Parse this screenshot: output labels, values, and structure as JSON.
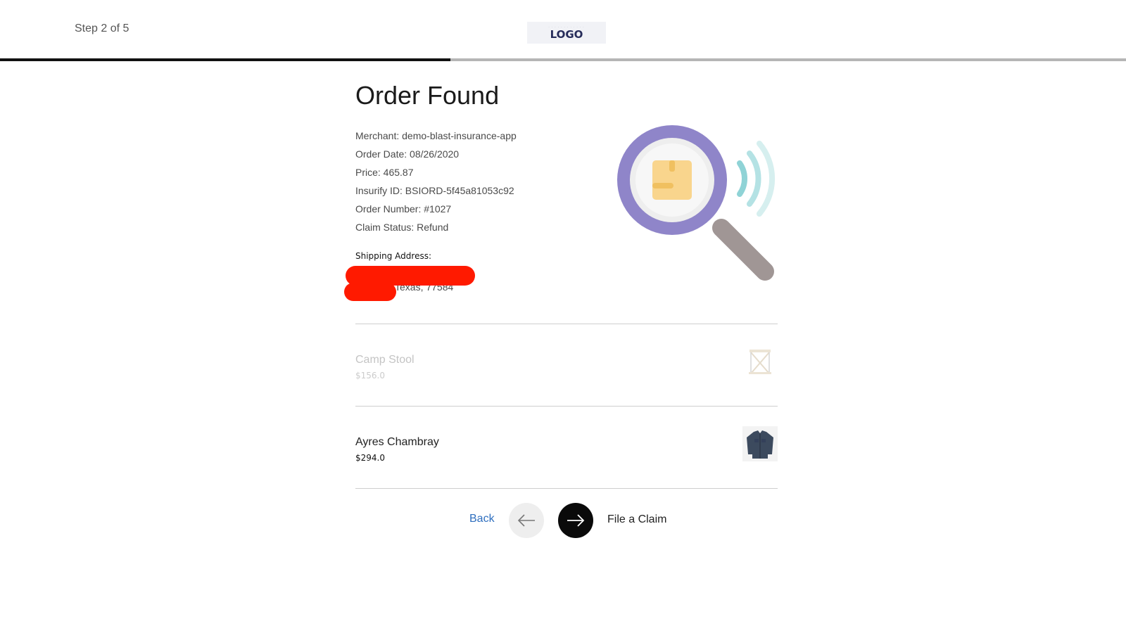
{
  "header": {
    "step_label": "Step 2 of 5",
    "logo_text": "LOGO",
    "progress_fraction": 0.4
  },
  "order": {
    "title": "Order Found",
    "info": [
      "Merchant: demo-blast-insurance-app",
      "Order Date: 08/26/2020",
      "Price: 465.87",
      "Insurify ID: BSIORD-5f45a81053c92",
      "Order Number: #1027",
      "Claim Status: Refund"
    ],
    "shipping_label": "Shipping Address:",
    "shipping_line2": "Texas, 77584"
  },
  "items": [
    {
      "name": "Camp Stool",
      "price": "$156.0",
      "disabled": true,
      "thumb_icon": "camp-stool-image"
    },
    {
      "name": "Ayres Chambray",
      "price": "$294.0",
      "disabled": false,
      "thumb_icon": "chambray-shirt-image"
    }
  ],
  "nav": {
    "back_label": "Back",
    "next_label": "File a Claim"
  },
  "colors": {
    "redaction": "#ff1a00",
    "link": "#2f6fbf",
    "progress_done": "#111111",
    "progress_todo": "#b5b5b5",
    "magnifier_ring": "#8f85c9",
    "signal": "#8fd3d6"
  }
}
